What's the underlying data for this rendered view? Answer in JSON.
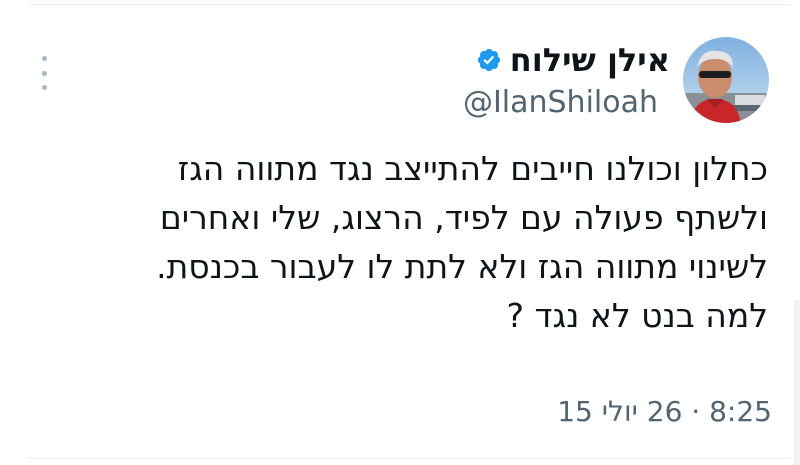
{
  "author": {
    "display_name": "אילן שילוח",
    "handle": "@IlanShiloah",
    "verified_icon": "verified-badge-icon",
    "verified_color": "#1d9bf0"
  },
  "tweet": {
    "lines": [
      "כחלון וכולנו חייבים להתייצב נגד מתווה הגז",
      "ולשתף פעולה עם לפיד, הרצוג, שלי ואחרים",
      "לשינוי מתווה הגז ולא לתת לו לעבור בכנסת.",
      "למה בנט לא נגד ?"
    ]
  },
  "meta": {
    "time": "8:25",
    "separator": "·",
    "date": "26 יולי 15"
  },
  "menu": {
    "icon": "more-vertical-icon"
  }
}
